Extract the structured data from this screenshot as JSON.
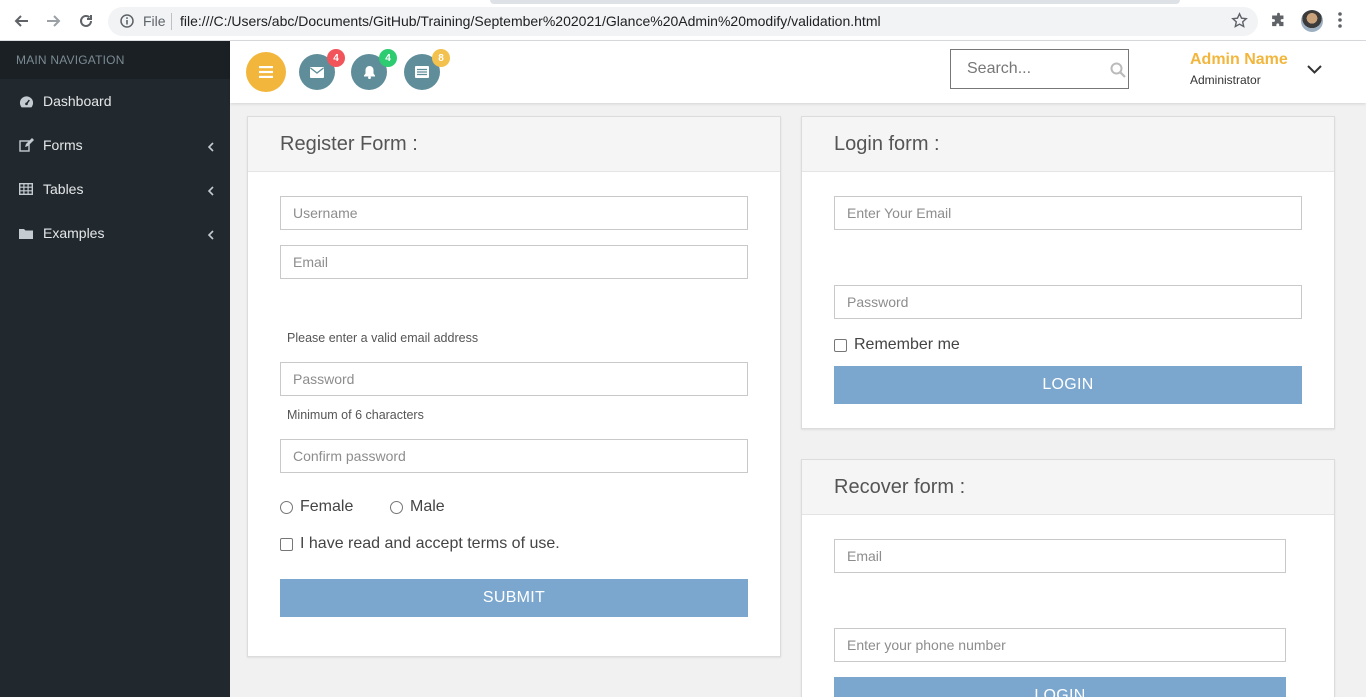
{
  "browser": {
    "file_label": "File",
    "url": "file:///C:/Users/abc/Documents/GitHub/Training/September%202021/Glance%20Admin%20modify/validation.html"
  },
  "sidebar": {
    "header": "MAIN NAVIGATION",
    "items": [
      {
        "label": "Dashboard",
        "icon": "dashboard-icon"
      },
      {
        "label": "Forms",
        "icon": "edit-icon"
      },
      {
        "label": "Tables",
        "icon": "table-icon"
      },
      {
        "label": "Examples",
        "icon": "folder-icon"
      }
    ]
  },
  "header": {
    "badges": {
      "messages": "4",
      "notifications": "4",
      "tasks": "8"
    },
    "badge_colors": {
      "messages": "#f2545b",
      "notifications": "#2ecc71",
      "tasks": "#f2c14e"
    },
    "search_placeholder": "Search...",
    "admin_name": "Admin Name",
    "admin_role": "Administrator"
  },
  "register": {
    "title": "Register Form :",
    "username_placeholder": "Username",
    "email_placeholder": "Email",
    "email_help": "Please enter a valid email address",
    "password_placeholder": "Password",
    "password_help": "Minimum of 6 characters",
    "confirm_placeholder": "Confirm password",
    "gender_female": "Female",
    "gender_male": "Male",
    "terms_label": "I have read and accept terms of use.",
    "submit_label": "SUBMIT"
  },
  "login": {
    "title": "Login form :",
    "email_placeholder": "Enter Your Email",
    "password_placeholder": "Password",
    "remember_label": "Remember me",
    "login_label": "LOGIN"
  },
  "recover": {
    "title": "Recover form :",
    "email_placeholder": "Email",
    "phone_placeholder": "Enter your phone number",
    "login_label": "LOGIN"
  },
  "colors": {
    "accent": "#f2b63c",
    "sidebar_bg": "#22292e",
    "button_blue": "#7ba7cf",
    "icon_button": "#5f8e9a"
  }
}
